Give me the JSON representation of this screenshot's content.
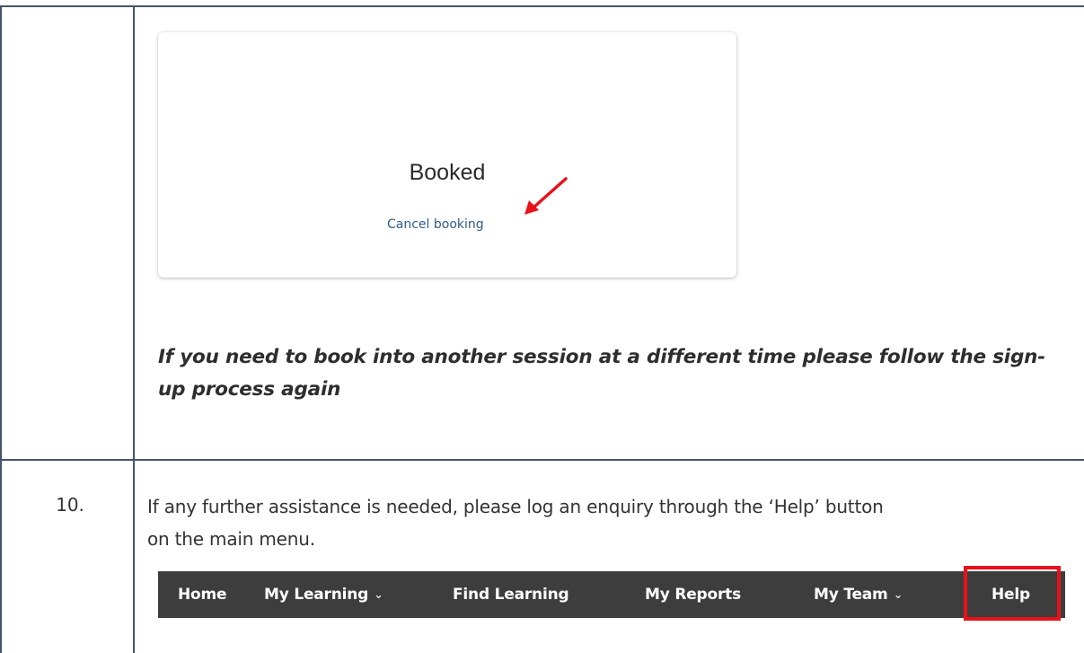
{
  "card": {
    "status": "Booked",
    "cancel_link": "Cancel booking"
  },
  "note": {
    "line1": "If you need to book into another session at a different time please follow the sign-",
    "line2": "up process again"
  },
  "step": {
    "number": "10.",
    "line1": "If any further assistance is needed, please log an enquiry through the ‘Help’ button",
    "line2": "on the main menu."
  },
  "navbar": {
    "home": "Home",
    "my_learning": "My Learning",
    "find_learning": "Find Learning",
    "my_reports": "My Reports",
    "my_team": "My Team",
    "help": "Help"
  },
  "colors": {
    "border": "#44546a",
    "navbar_bg": "#3d3d3d",
    "highlight": "#e8121b",
    "link": "#2f5b8c"
  },
  "icons": [
    "chevron-down-icon",
    "red-arrow-annotation"
  ]
}
